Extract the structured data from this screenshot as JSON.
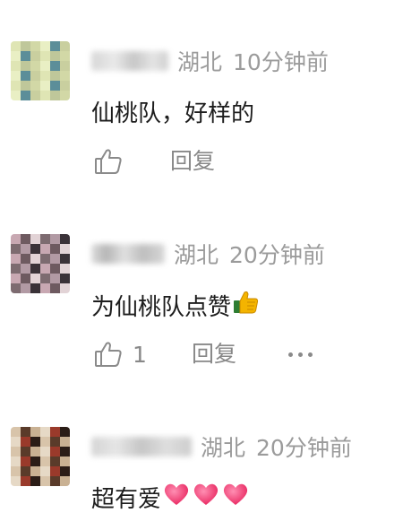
{
  "comments": [
    {
      "location": "湖北",
      "time": "10分钟前",
      "text": "仙桃队，好样的",
      "emoji": "",
      "likes": "",
      "reply_label": "回复",
      "has_more": false,
      "avatar_colors": [
        "#dfe5b4",
        "#c9cf9f",
        "#5c8e99",
        "#e9efc4",
        "#d2d8a6",
        "#bfc79a"
      ]
    },
    {
      "location": "湖北",
      "time": "20分钟前",
      "text": "为仙桃队点赞",
      "emoji": "thumbs-up",
      "likes": "1",
      "reply_label": "回复",
      "has_more": true,
      "avatar_colors": [
        "#6e5a60",
        "#c8a8b2",
        "#3a3238",
        "#b29aa4",
        "#7d6b70",
        "#e2d3d6"
      ]
    },
    {
      "location": "湖北",
      "time": "20分钟前",
      "text": "超有爱",
      "emoji": "three-hearts",
      "likes": "",
      "reply_label": "",
      "has_more": false,
      "avatar_colors": [
        "#c9b193",
        "#5a3b2a",
        "#d8c4aa",
        "#2b1d17",
        "#9a3a2b",
        "#e6d9c6"
      ]
    }
  ]
}
